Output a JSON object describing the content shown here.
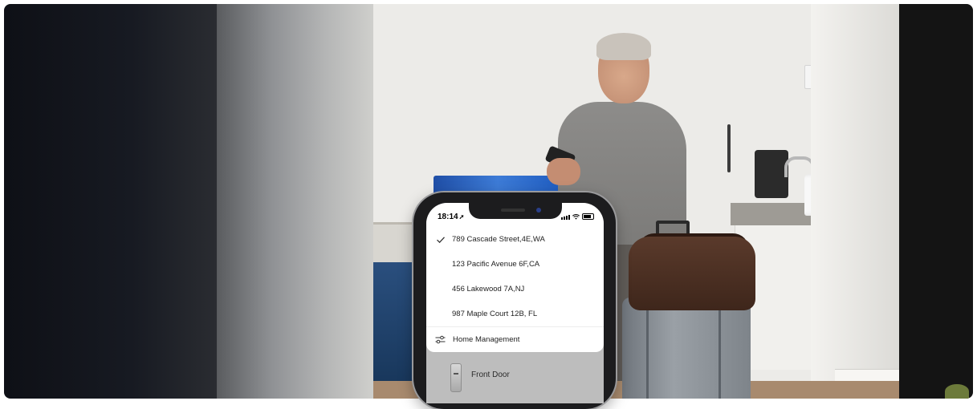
{
  "status_bar": {
    "time": "18:14",
    "location_arrow": "➚"
  },
  "home_menu": {
    "selected_index": 0,
    "addresses": [
      "789 Cascade Street,4E,WA",
      "123 Pacific Avenue 6F,CA",
      "456 Lakewood 7A,NJ",
      "987 Maple Court 12B, FL"
    ],
    "management_label": "Home Management"
  },
  "device_card": {
    "name": "Front Door"
  },
  "icons": {
    "selected": "checkmark-icon",
    "management": "sliders-icon",
    "device": "door-lock-icon"
  }
}
